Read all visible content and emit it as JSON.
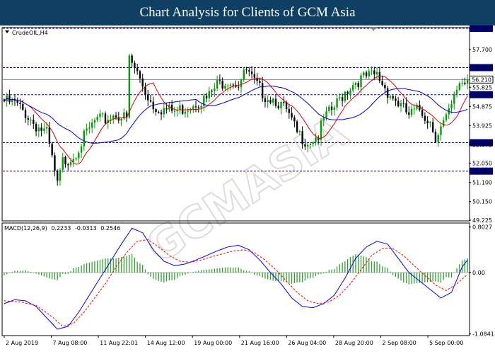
{
  "header": {
    "title": "Chart Analysis for Clients of GCM Asia"
  },
  "chart_data": [
    {
      "type": "candlestick",
      "symbol_label": "CrudeOIL,H4",
      "ylim": [
        49.225,
        58.755
      ],
      "y_ticks": [
        "58.755",
        "57.700",
        "56.804",
        "56.210",
        "55.825",
        "55.459",
        "54.875",
        "53.925",
        "53.074",
        "52.975",
        "52.050",
        "51.662",
        "51.100",
        "50.150",
        "49.225"
      ],
      "levels": [
        {
          "value": 58.755,
          "label": "58.755"
        },
        {
          "value": 56.804,
          "label": "56.804"
        },
        {
          "value": 55.459,
          "label": "55.459"
        },
        {
          "value": 53.074,
          "label": "53.074"
        },
        {
          "value": 51.662,
          "label": "51.662"
        }
      ],
      "current_price": {
        "value": 56.21,
        "label": "56.210"
      },
      "x_labels": [
        "2 Aug 2019",
        "7 Aug 08:00",
        "11 Aug 22:01",
        "14 Aug 12:00",
        "19 Aug 00:00",
        "21 Aug 16:00",
        "26 Aug 04:00",
        "28 Aug 20:00",
        "2 Sep 08:00",
        "5 Sep 00:00"
      ],
      "close_anchors": [
        [
          0,
          55.3
        ],
        [
          4,
          55.2
        ],
        [
          8,
          54.7
        ],
        [
          12,
          54.1
        ],
        [
          16,
          53.7
        ],
        [
          20,
          51.1
        ],
        [
          22,
          52.3
        ],
        [
          26,
          52.6
        ],
        [
          30,
          53.5
        ],
        [
          34,
          54.3
        ],
        [
          38,
          54.4
        ],
        [
          42,
          54.7
        ],
        [
          46,
          54.4
        ],
        [
          47,
          57.4
        ],
        [
          50,
          56.7
        ],
        [
          53,
          55.8
        ],
        [
          56,
          55.1
        ],
        [
          60,
          54.9
        ],
        [
          64,
          54.8
        ],
        [
          68,
          55.0
        ],
        [
          72,
          55.3
        ],
        [
          76,
          55.4
        ],
        [
          80,
          56.1
        ],
        [
          84,
          56.4
        ],
        [
          88,
          56.2
        ],
        [
          91,
          56.8
        ],
        [
          94,
          56.2
        ],
        [
          98,
          55.6
        ],
        [
          102,
          55.4
        ],
        [
          106,
          54.8
        ],
        [
          110,
          53.7
        ],
        [
          114,
          53.3
        ],
        [
          118,
          53.6
        ],
        [
          120,
          54.4
        ],
        [
          124,
          55.0
        ],
        [
          128,
          55.8
        ],
        [
          132,
          56.3
        ],
        [
          136,
          56.5
        ],
        [
          140,
          56.6
        ],
        [
          144,
          55.8
        ],
        [
          148,
          55.2
        ],
        [
          152,
          54.6
        ],
        [
          156,
          54.9
        ],
        [
          160,
          54.3
        ],
        [
          162,
          53.6
        ],
        [
          166,
          54.4
        ],
        [
          168,
          55.0
        ],
        [
          171,
          56.3
        ],
        [
          174,
          56.21
        ]
      ],
      "indicator": {
        "name": "MACD(12,26,9)",
        "values": [
          "0.2233",
          "-0.0313",
          "0.2546"
        ],
        "ylim": [
          -1.1,
          0.86
        ],
        "y_ticks": [
          "0.8027",
          "0.00",
          "-1.0841"
        ],
        "main_anchors": [
          [
            0,
            -0.55
          ],
          [
            4,
            -0.48
          ],
          [
            8,
            -0.5
          ],
          [
            12,
            -0.6
          ],
          [
            16,
            -0.8
          ],
          [
            20,
            -1.0
          ],
          [
            24,
            -0.95
          ],
          [
            28,
            -0.7
          ],
          [
            32,
            -0.4
          ],
          [
            36,
            -0.1
          ],
          [
            40,
            0.2
          ],
          [
            44,
            0.5
          ],
          [
            48,
            0.78
          ],
          [
            52,
            0.7
          ],
          [
            56,
            0.4
          ],
          [
            60,
            0.2
          ],
          [
            64,
            0.12
          ],
          [
            68,
            0.15
          ],
          [
            72,
            0.22
          ],
          [
            76,
            0.3
          ],
          [
            80,
            0.38
          ],
          [
            84,
            0.45
          ],
          [
            88,
            0.48
          ],
          [
            92,
            0.4
          ],
          [
            96,
            0.22
          ],
          [
            100,
            0.0
          ],
          [
            104,
            -0.2
          ],
          [
            108,
            -0.45
          ],
          [
            112,
            -0.6
          ],
          [
            116,
            -0.62
          ],
          [
            120,
            -0.55
          ],
          [
            124,
            -0.4
          ],
          [
            128,
            -0.1
          ],
          [
            132,
            0.25
          ],
          [
            136,
            0.45
          ],
          [
            140,
            0.55
          ],
          [
            144,
            0.5
          ],
          [
            148,
            0.25
          ],
          [
            152,
            0.0
          ],
          [
            156,
            -0.15
          ],
          [
            160,
            -0.3
          ],
          [
            164,
            -0.45
          ],
          [
            168,
            -0.35
          ],
          [
            172,
            0.1
          ],
          [
            174,
            0.22
          ]
        ],
        "signal_anchors": [
          [
            0,
            -0.5
          ],
          [
            6,
            -0.52
          ],
          [
            12,
            -0.58
          ],
          [
            18,
            -0.78
          ],
          [
            22,
            -0.95
          ],
          [
            26,
            -0.9
          ],
          [
            30,
            -0.7
          ],
          [
            34,
            -0.45
          ],
          [
            38,
            -0.2
          ],
          [
            42,
            0.1
          ],
          [
            46,
            0.35
          ],
          [
            50,
            0.55
          ],
          [
            54,
            0.58
          ],
          [
            58,
            0.45
          ],
          [
            62,
            0.3
          ],
          [
            66,
            0.2
          ],
          [
            70,
            0.18
          ],
          [
            74,
            0.22
          ],
          [
            78,
            0.28
          ],
          [
            82,
            0.33
          ],
          [
            86,
            0.38
          ],
          [
            90,
            0.4
          ],
          [
            94,
            0.35
          ],
          [
            98,
            0.22
          ],
          [
            102,
            0.05
          ],
          [
            106,
            -0.15
          ],
          [
            110,
            -0.35
          ],
          [
            114,
            -0.5
          ],
          [
            118,
            -0.55
          ],
          [
            122,
            -0.52
          ],
          [
            126,
            -0.4
          ],
          [
            130,
            -0.2
          ],
          [
            134,
            0.05
          ],
          [
            138,
            0.3
          ],
          [
            142,
            0.42
          ],
          [
            146,
            0.42
          ],
          [
            150,
            0.3
          ],
          [
            154,
            0.12
          ],
          [
            158,
            -0.05
          ],
          [
            162,
            -0.22
          ],
          [
            166,
            -0.32
          ],
          [
            170,
            -0.2
          ],
          [
            174,
            -0.03
          ]
        ]
      }
    }
  ],
  "colors": {
    "header_bg": "#0f3f63",
    "bull": "#00a000",
    "bear": "#000000",
    "ma_fast": "#e00000",
    "ma_slow": "#0000e0",
    "level_line": "#0000c0",
    "level_label_bg": "#000080",
    "macd_hist": "#30a030",
    "macd_main": "#0000ff",
    "macd_signal": "#ff0000"
  },
  "watermark": "GCMASIA"
}
